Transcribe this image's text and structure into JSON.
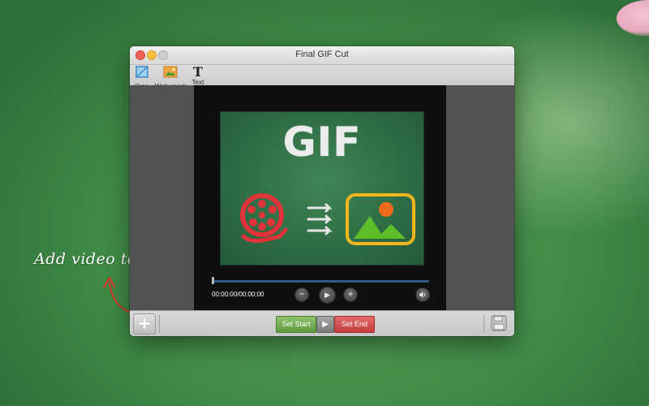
{
  "window": {
    "title": "Final GIF Cut"
  },
  "toolbar": {
    "crop_label": "Crop",
    "watermark_label": "Watermark",
    "text_label": "Text",
    "text_glyph": "T"
  },
  "player": {
    "thumbnail_word": "GIF",
    "time_readout": "00:00:00/00:00:00",
    "progress": 0,
    "minus_glyph": "−",
    "plus_glyph": "+",
    "play_glyph": "▶",
    "volume_glyph": "🔊"
  },
  "bottombar": {
    "add_glyph": "+",
    "set_start_label": "Set Start",
    "play_glyph": "▶",
    "set_end_label": "Set End"
  },
  "desktop": {
    "hint_text": "Add video to start."
  },
  "colors": {
    "set_start": "#6fa84d",
    "set_end": "#d24a4a",
    "progress_track": "#2b5d88",
    "desktop_green": "#4a944f"
  },
  "icons": [
    "crop-icon",
    "watermark-icon",
    "text-icon",
    "minus-icon",
    "play-icon",
    "plus-icon",
    "volume-icon",
    "add-icon",
    "save-icon",
    "arrow-icon"
  ]
}
